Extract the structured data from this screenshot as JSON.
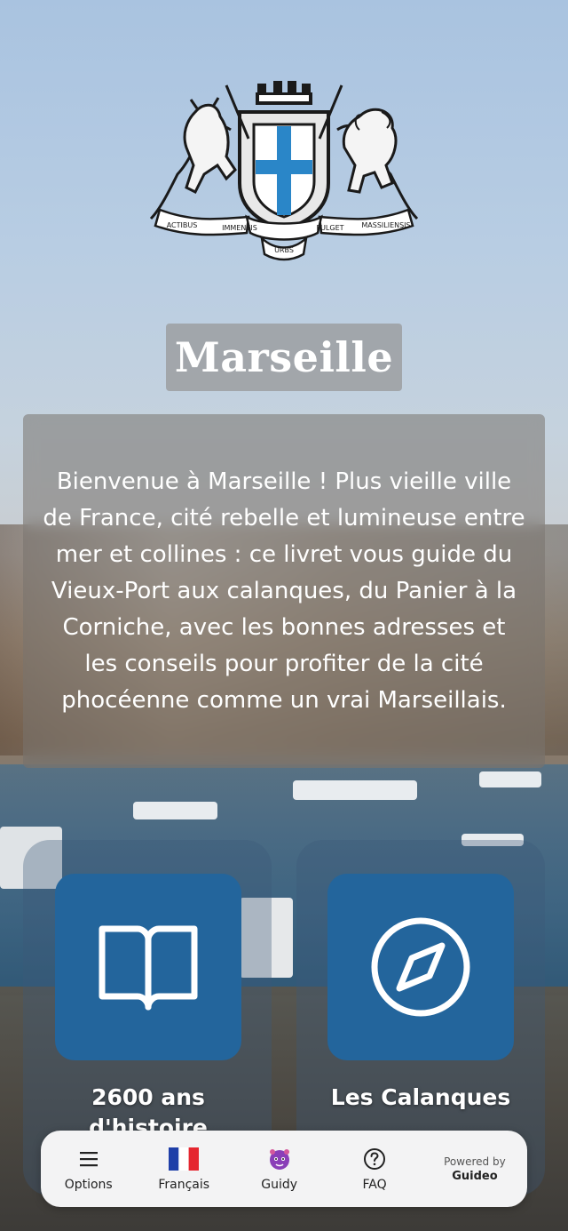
{
  "city": {
    "title": "Marseille",
    "intro": "Bienvenue à Marseille ! Plus vieille ville de France, cité rebelle et lumineuse entre mer et collines : ce livret vous guide du Vieux-Port aux calanques, du Panier à la Corniche, avec les bonnes adresses et les conseils pour profiter de la cité phocéenne comme un vrai Marseillais."
  },
  "crest": {
    "motto_words": [
      "ACTIBUS",
      "IMMENSIS",
      "URBS",
      "FULGET",
      "MASSILIENSIS"
    ]
  },
  "tiles": [
    {
      "label": "2600 ans d'histoire",
      "icon": "book-open-icon"
    },
    {
      "label": "Les Calanques",
      "icon": "compass-icon"
    }
  ],
  "nav": {
    "options": "Options",
    "language": "Français",
    "guidy": "Guidy",
    "faq": "FAQ",
    "powered_by": "Powered by",
    "brand": "Guideo"
  },
  "colors": {
    "tile": "#23659c",
    "nav_bg": "#f3f3f4",
    "text_light": "#ffffff"
  }
}
